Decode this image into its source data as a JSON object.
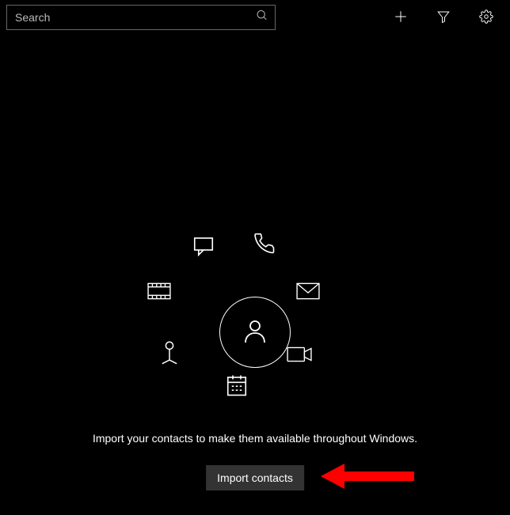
{
  "search": {
    "placeholder": "Search"
  },
  "empty": {
    "message": "Import your contacts to make them available throughout Windows.",
    "button_label": "Import contacts"
  }
}
